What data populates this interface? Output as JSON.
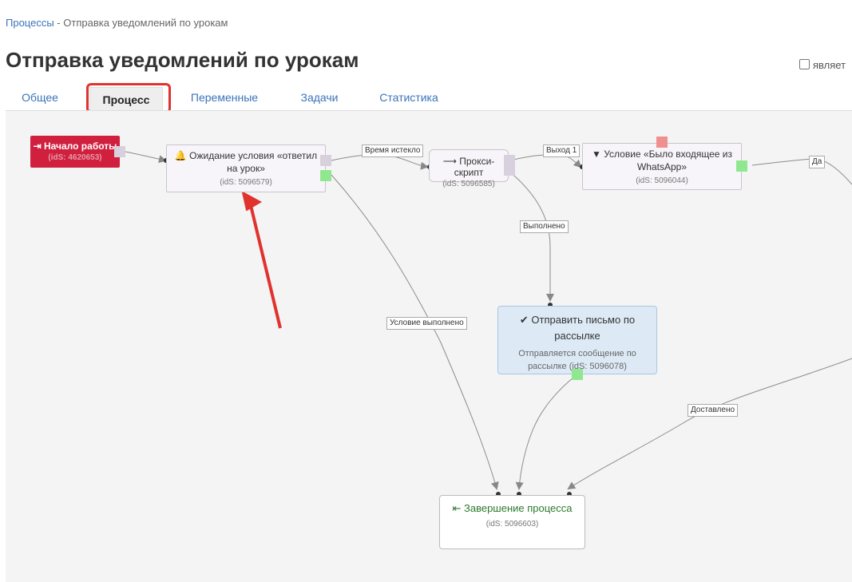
{
  "breadcrumb": {
    "parent": "Процессы",
    "separator": " - ",
    "current": "Отправка уведомлений по урокам"
  },
  "page": {
    "title": "Отправка уведомлений по урокам",
    "flag_label": "являет"
  },
  "tabs": [
    {
      "label": "Общее"
    },
    {
      "label": "Процесс",
      "active": true
    },
    {
      "label": "Переменные"
    },
    {
      "label": "Задачи"
    },
    {
      "label": "Статистика"
    }
  ],
  "nodes": {
    "start": {
      "icon": "sign-in-icon",
      "title": "Начало работы",
      "ids": "(idS: 4620653)"
    },
    "wait": {
      "icon": "bell-icon",
      "title": "Ожидание условия «ответил на урок»",
      "ids": "(idS: 5096579)"
    },
    "proxy": {
      "icon": "arrow-right-icon",
      "title": "Прокси-скрипт",
      "ids": "(idS: 5096585)"
    },
    "condition": {
      "icon": "filter-icon",
      "title": "Условие «Было входящее из WhatsApp»",
      "ids": "(idS: 5096044)"
    },
    "mail": {
      "icon": "check-icon",
      "title": "Отправить письмо по рассылке",
      "description": "Отправляется сообщение по рассылке",
      "ids": "(idS: 5096078)"
    },
    "finish": {
      "icon": "sign-out-icon",
      "title": "Завершение процесса",
      "ids": "(idS: 5096603)"
    }
  },
  "edge_labels": {
    "timeout": "Время истекло",
    "exit1": "Выход 1",
    "yes": "Да",
    "done": "Выполнено",
    "condition_met": "Условие выполнено",
    "delivered": "Доставлено"
  },
  "colors": {
    "accent_link": "#3b73b9",
    "start_node": "#d0203e",
    "annotation_arrow": "#e0332e",
    "highlight_box": "#e0332e",
    "success_port": "#8fe88f"
  }
}
